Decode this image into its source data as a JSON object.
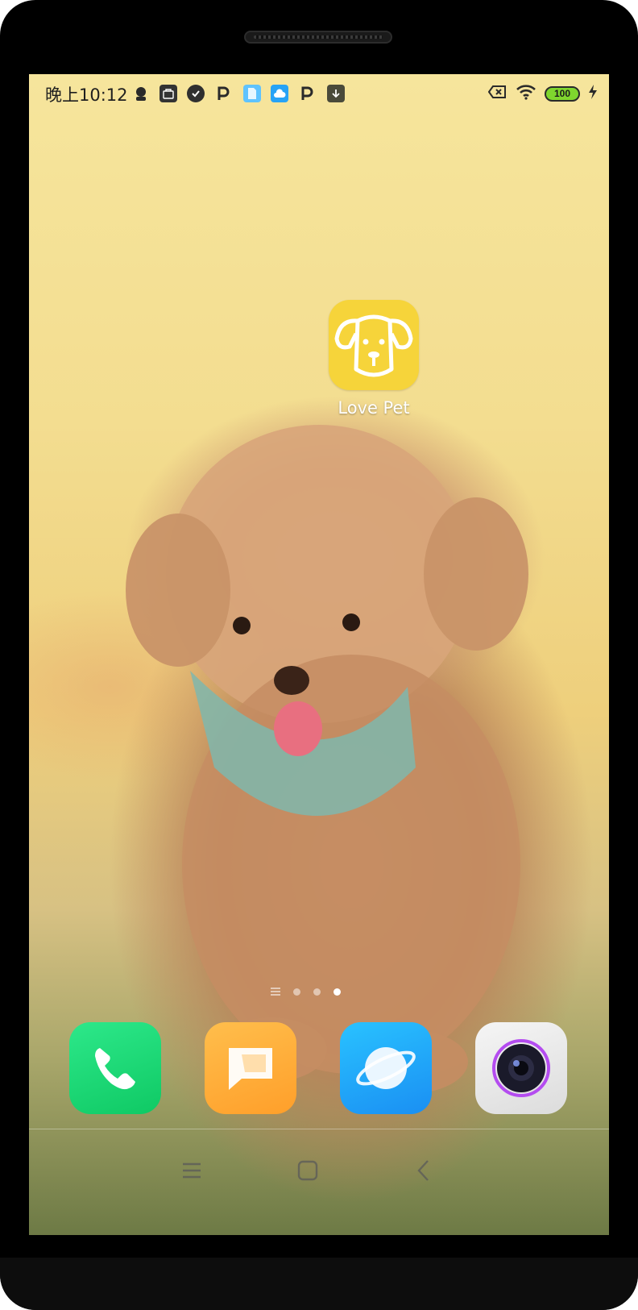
{
  "status_bar": {
    "time": "晚上10:12",
    "notification_icons": [
      "avatar-icon",
      "mi-store-icon",
      "check-icon",
      "p-icon",
      "file-icon",
      "cloud-icon",
      "p-icon",
      "download-icon"
    ],
    "battery_level": "100"
  },
  "home": {
    "apps": [
      {
        "label": "Love Pet",
        "icon": "dog-face-icon",
        "color": "#f6d43a"
      }
    ],
    "page_indicator": {
      "pages": 3,
      "current": 3
    }
  },
  "dock": {
    "apps": [
      {
        "icon": "phone-icon",
        "color": "#1bd674"
      },
      {
        "icon": "messages-icon",
        "color": "#ffaa33"
      },
      {
        "icon": "browser-icon",
        "color": "#1ea9fa"
      },
      {
        "icon": "camera-icon",
        "color": "#e8e8e8"
      }
    ]
  },
  "nav_bar": {
    "buttons": [
      "menu-icon",
      "home-icon",
      "back-icon"
    ]
  }
}
